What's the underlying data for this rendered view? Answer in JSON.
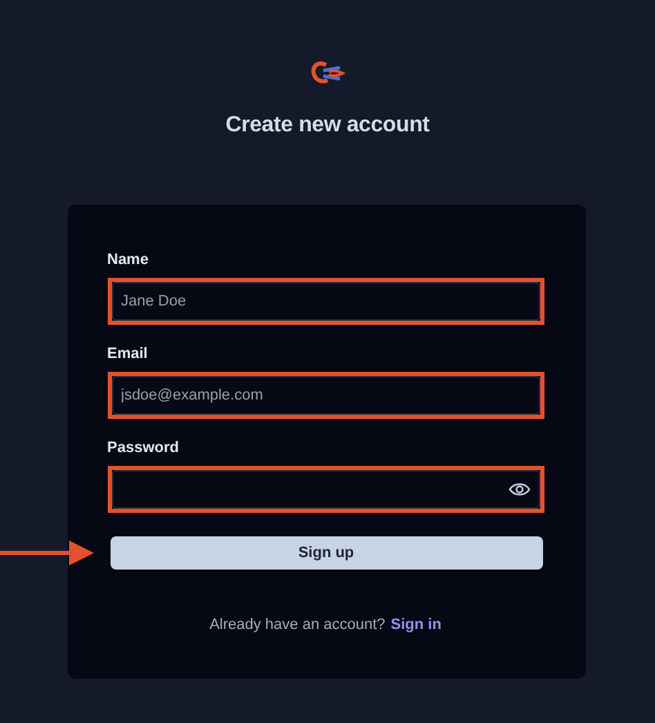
{
  "title": "Create new account",
  "fields": [
    {
      "kind": "text",
      "label": "Name",
      "placeholder": "Jane Doe",
      "highlighted": true
    },
    {
      "kind": "text",
      "label": "Email",
      "placeholder": "jsdoe@example.com",
      "highlighted": true
    },
    {
      "kind": "password",
      "label": "Password",
      "highlighted": true
    }
  ],
  "signup_button": {
    "label": "Sign up",
    "pointed_at": true
  },
  "footer": {
    "text": "Already have an account?",
    "link": "Sign in"
  }
}
